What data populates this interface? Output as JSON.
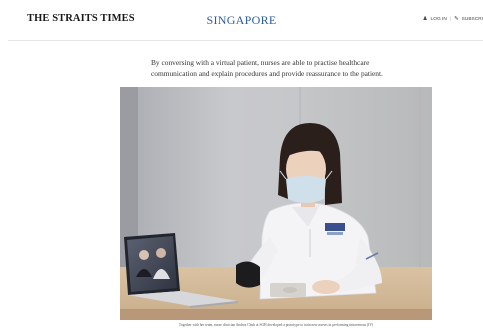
{
  "header": {
    "logo": "THE STRAITS TIMES",
    "section": "SINGAPORE",
    "login": "LOG IN",
    "subscribe": "SUBSCRI"
  },
  "article": {
    "lede": "By conversing with a virtual patient, nurses are able to practise healthcare communication and explain procedures and provide reassurance to the patient.",
    "caption": "Together with her team, nurse clinician Andrea Chuh at SGH developed a prototype to train new nurses in performing intravenous (IV)"
  },
  "icons": {
    "login": "user-icon",
    "subscribe": "subscribe-icon"
  },
  "colors": {
    "section": "#2c5b9e"
  }
}
